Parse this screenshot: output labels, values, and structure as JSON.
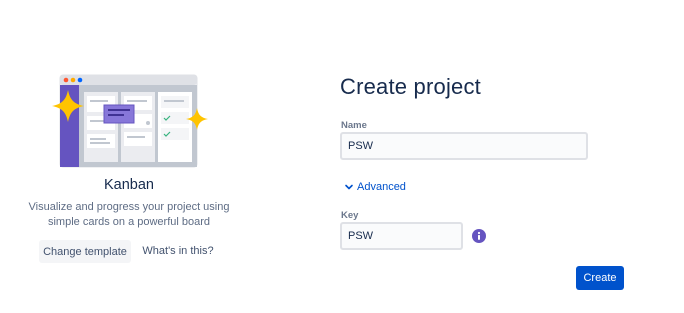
{
  "template": {
    "title": "Kanban",
    "description": "Visualize and progress your project using simple cards on a powerful board",
    "change_template_label": "Change template",
    "whats_this_label": "What's in this?",
    "illustration_icons": [
      "kanban-board-illustration",
      "sparkle-icon"
    ]
  },
  "form": {
    "title": "Create project",
    "name": {
      "label": "Name",
      "value": "PSW"
    },
    "advanced": {
      "label": "Advanced",
      "icon": "chevron-down-icon"
    },
    "key": {
      "label": "Key",
      "value": "PSW",
      "info_icon": "info-icon"
    },
    "create_label": "Create"
  },
  "colors": {
    "primary": "#0052cc",
    "info_purple": "#6554c0",
    "illustration_purple": "#6554c0",
    "sparkle_yellow": "#ffc400",
    "heading_text": "#172b4d",
    "subtle_text": "#5e6c84"
  }
}
